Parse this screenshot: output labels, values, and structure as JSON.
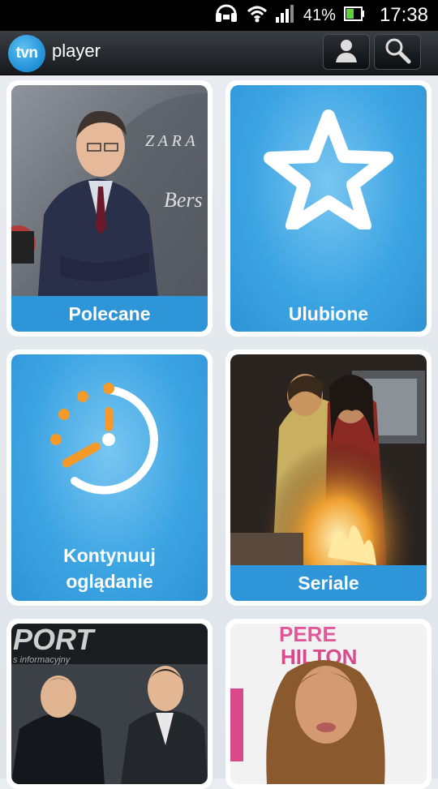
{
  "status_bar": {
    "battery_percent": "41%",
    "time": "17:38",
    "icons": [
      "headset-icon",
      "wifi-icon",
      "signal-icon",
      "battery-icon"
    ]
  },
  "app_bar": {
    "logo_text": "tvn",
    "title": "player",
    "actions": [
      "account-icon",
      "search-icon"
    ]
  },
  "tiles": [
    {
      "label": "Polecane",
      "kind": "photo"
    },
    {
      "label": "Ulubione",
      "kind": "icon",
      "icon": "star-icon"
    },
    {
      "label_line1": "Kontynuuj",
      "label_line2": "oglądanie",
      "kind": "icon",
      "icon": "clock-icon"
    },
    {
      "label": "Seriale",
      "kind": "photo"
    },
    {
      "photo_text_top": "PORT",
      "photo_text_sub": "s informacyjny",
      "kind": "photo"
    },
    {
      "photo_text_top": "PERE",
      "photo_text_sub": "HILTON",
      "kind": "photo"
    }
  ],
  "colors": {
    "accent": "#2d95d8",
    "status_bar": "#000000",
    "app_bar": "#1e2226"
  }
}
